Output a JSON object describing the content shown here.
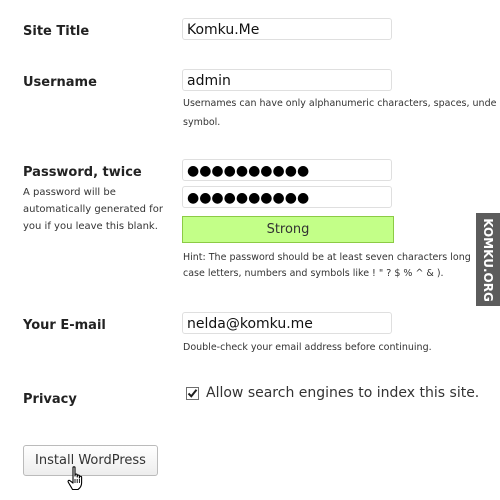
{
  "site_title": {
    "label": "Site Title",
    "value": "Komku.Me"
  },
  "username": {
    "label": "Username",
    "value": "admin",
    "help_line1": "Usernames can have only alphanumeric characters, spaces, unde",
    "help_line2": "symbol."
  },
  "password": {
    "label": "Password, twice",
    "note_line1": "A password will be",
    "note_line2": "automatically generated for",
    "note_line3": "you if you leave this blank.",
    "value1_masked": "●●●●●●●●●●",
    "value2_masked": "●●●●●●●●●●",
    "strength": "Strong",
    "strength_color": "#c3ff88",
    "hint_line1": "Hint: The password should be at least seven characters long",
    "hint_line2": "case letters, numbers and symbols like ! \" ? $ % ^ & )."
  },
  "email": {
    "label": "Your E-mail",
    "value": "nelda@komku.me",
    "help": "Double-check your email address before continuing."
  },
  "privacy": {
    "label": "Privacy",
    "checked": true,
    "checkbox_label": "Allow search engines to index this site."
  },
  "install_button": {
    "label": "Install WordPress"
  },
  "cursor": {
    "icon": "hand-pointer-icon"
  },
  "watermark": {
    "text": "KOMKU.ORG"
  }
}
